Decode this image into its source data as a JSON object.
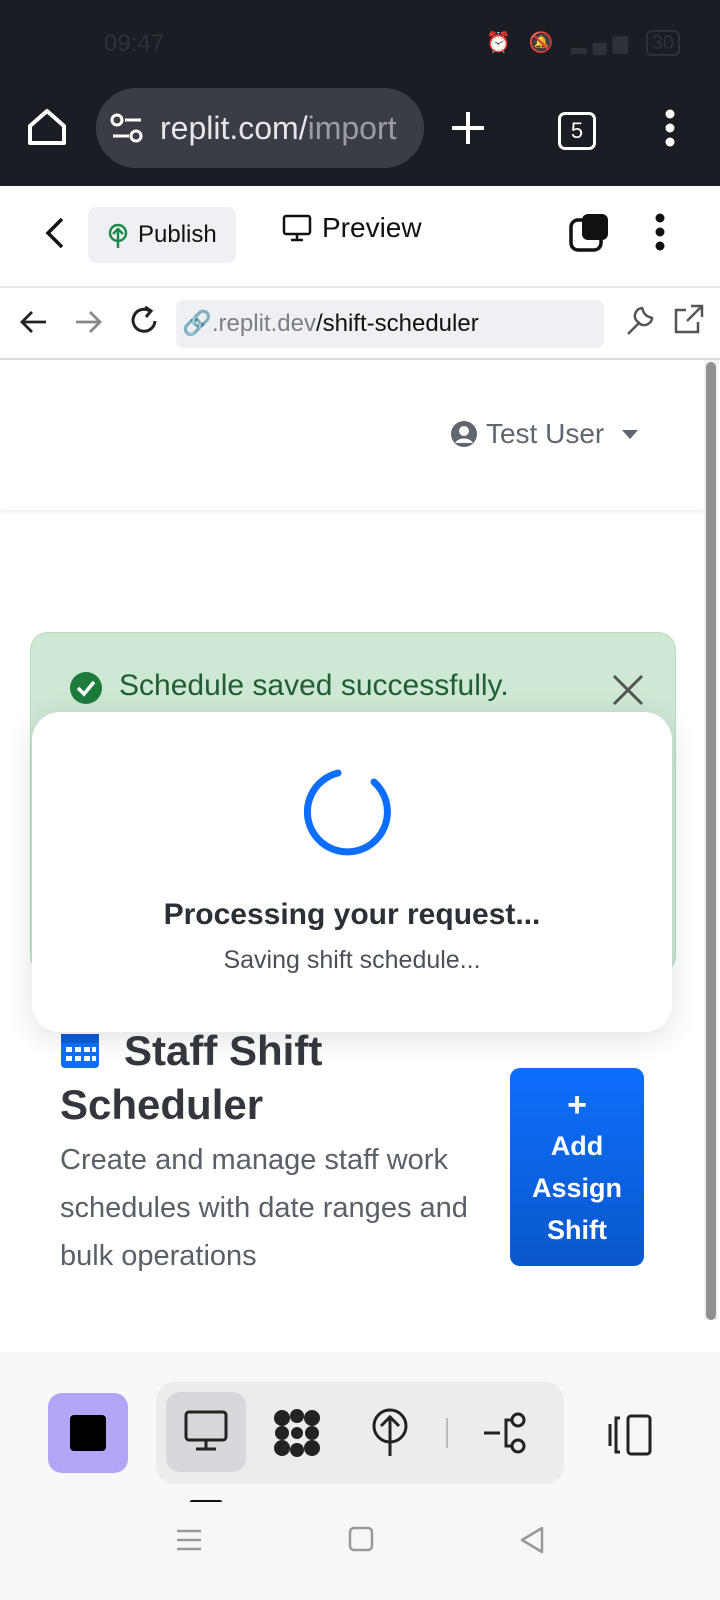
{
  "status_bar": {
    "time": "09:47",
    "battery": "30"
  },
  "browser": {
    "url_host": "replit.com/",
    "url_path": "import",
    "tab_count": "5"
  },
  "replit_toolbar": {
    "publish_label": "Publish",
    "preview_label": "Preview"
  },
  "address_bar": {
    "url_domain": ".replit.dev",
    "url_path": "/shift-scheduler"
  },
  "page": {
    "user_name": "Test User",
    "alert_text": "Schedule saved successfully.",
    "modal": {
      "title": "Processing your request...",
      "subtitle": "Saving shift schedule..."
    },
    "heading": "Staff Shift Scheduler",
    "description": "Create and manage staff work schedules with date ranges and bulk operations",
    "add_button": {
      "plus": "+",
      "label": "Add Assign Shift"
    }
  },
  "colors": {
    "accent": "#0d6efd",
    "success_bg": "#cfe8d5",
    "success_text": "#1f5f33",
    "stop_button": "#b3a4f5"
  }
}
